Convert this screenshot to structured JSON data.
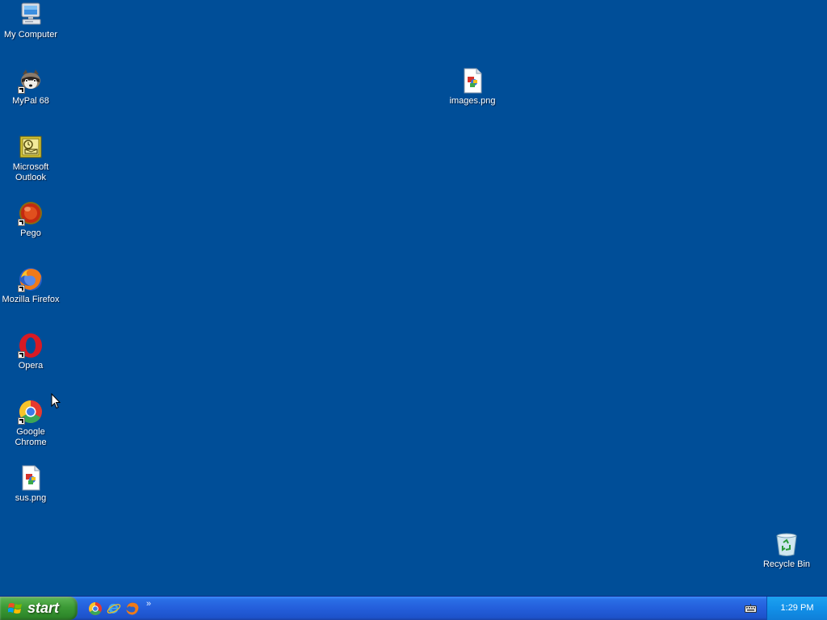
{
  "desktop": {
    "background": "#004e98",
    "icons": [
      {
        "label": "My Computer",
        "icon": "my-computer-icon"
      },
      {
        "label": "MyPal 68",
        "icon": "mypal-icon",
        "shortcut": true
      },
      {
        "label": "Microsoft Outlook",
        "icon": "outlook-icon"
      },
      {
        "label": "Pego",
        "icon": "pego-icon",
        "shortcut": true
      },
      {
        "label": "Mozilla Firefox",
        "icon": "firefox-icon",
        "shortcut": true
      },
      {
        "label": "Opera",
        "icon": "opera-icon",
        "shortcut": true
      },
      {
        "label": "Google Chrome",
        "icon": "chrome-icon",
        "shortcut": true
      },
      {
        "label": "sus.png",
        "icon": "image-file-icon"
      },
      {
        "label": "images.png",
        "icon": "image-file-icon"
      },
      {
        "label": "Recycle Bin",
        "icon": "recycle-bin-icon"
      }
    ]
  },
  "taskbar": {
    "start_label": "start",
    "quick_launch": [
      "chrome-icon",
      "internet-explorer-icon",
      "firefox-icon"
    ],
    "overflow": "»",
    "clock": "1:29 PM",
    "tray_icons": [
      "keyboard-icon"
    ]
  },
  "colors": {
    "taskbar": "#245edb",
    "start_button": "#3c9a36",
    "tray": "#1290e8"
  }
}
